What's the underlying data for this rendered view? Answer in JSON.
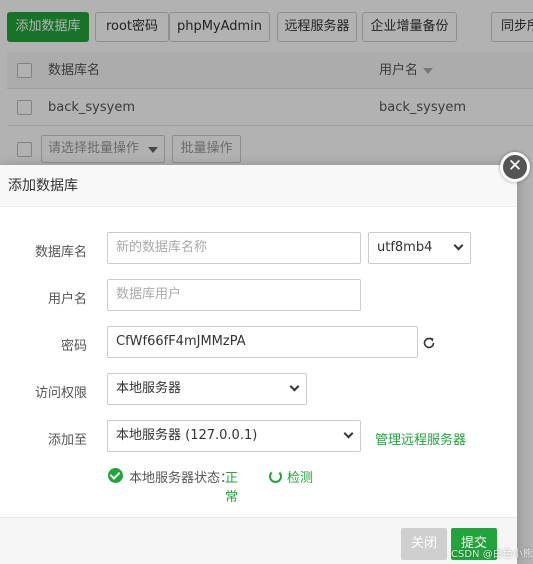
{
  "toolbar": {
    "add_db": "添加数据库",
    "root_pwd": "root密码",
    "phpmyadmin": "phpMyAdmin",
    "remote_server": "远程服务器",
    "enterprise_backup": "企业增量备份",
    "sync": "同步所"
  },
  "table": {
    "headers": {
      "name": "数据库名",
      "user": "用户名"
    },
    "rows": [
      {
        "name": "back_sysyem",
        "user": "back_sysyem"
      }
    ]
  },
  "batch": {
    "select_placeholder": "请选择批量操作",
    "button": "批量操作"
  },
  "modal": {
    "title": "添加数据库",
    "db_name": {
      "label": "数据库名",
      "placeholder": "新的数据库名称",
      "charset": "utf8mb4"
    },
    "username": {
      "label": "用户名",
      "placeholder": "数据库用户"
    },
    "password": {
      "label": "密码",
      "value": "CfWf66fF4mJMMzPA"
    },
    "access": {
      "label": "访问权限",
      "value": "本地服务器"
    },
    "add_to": {
      "label": "添加至",
      "value": "本地服务器 (127.0.0.1)",
      "manage_link": "管理远程服务器"
    },
    "status": {
      "label": "本地服务器状态：",
      "value": "正常",
      "check_link": "检测"
    },
    "close_button": "关闭",
    "submit_button": "提交",
    "close_glyph": "✕"
  },
  "watermark": "CSDN @白色小熊",
  "colors": {
    "accent": "#20a53a",
    "overlay": "rgba(0,0,0,0.30)"
  }
}
